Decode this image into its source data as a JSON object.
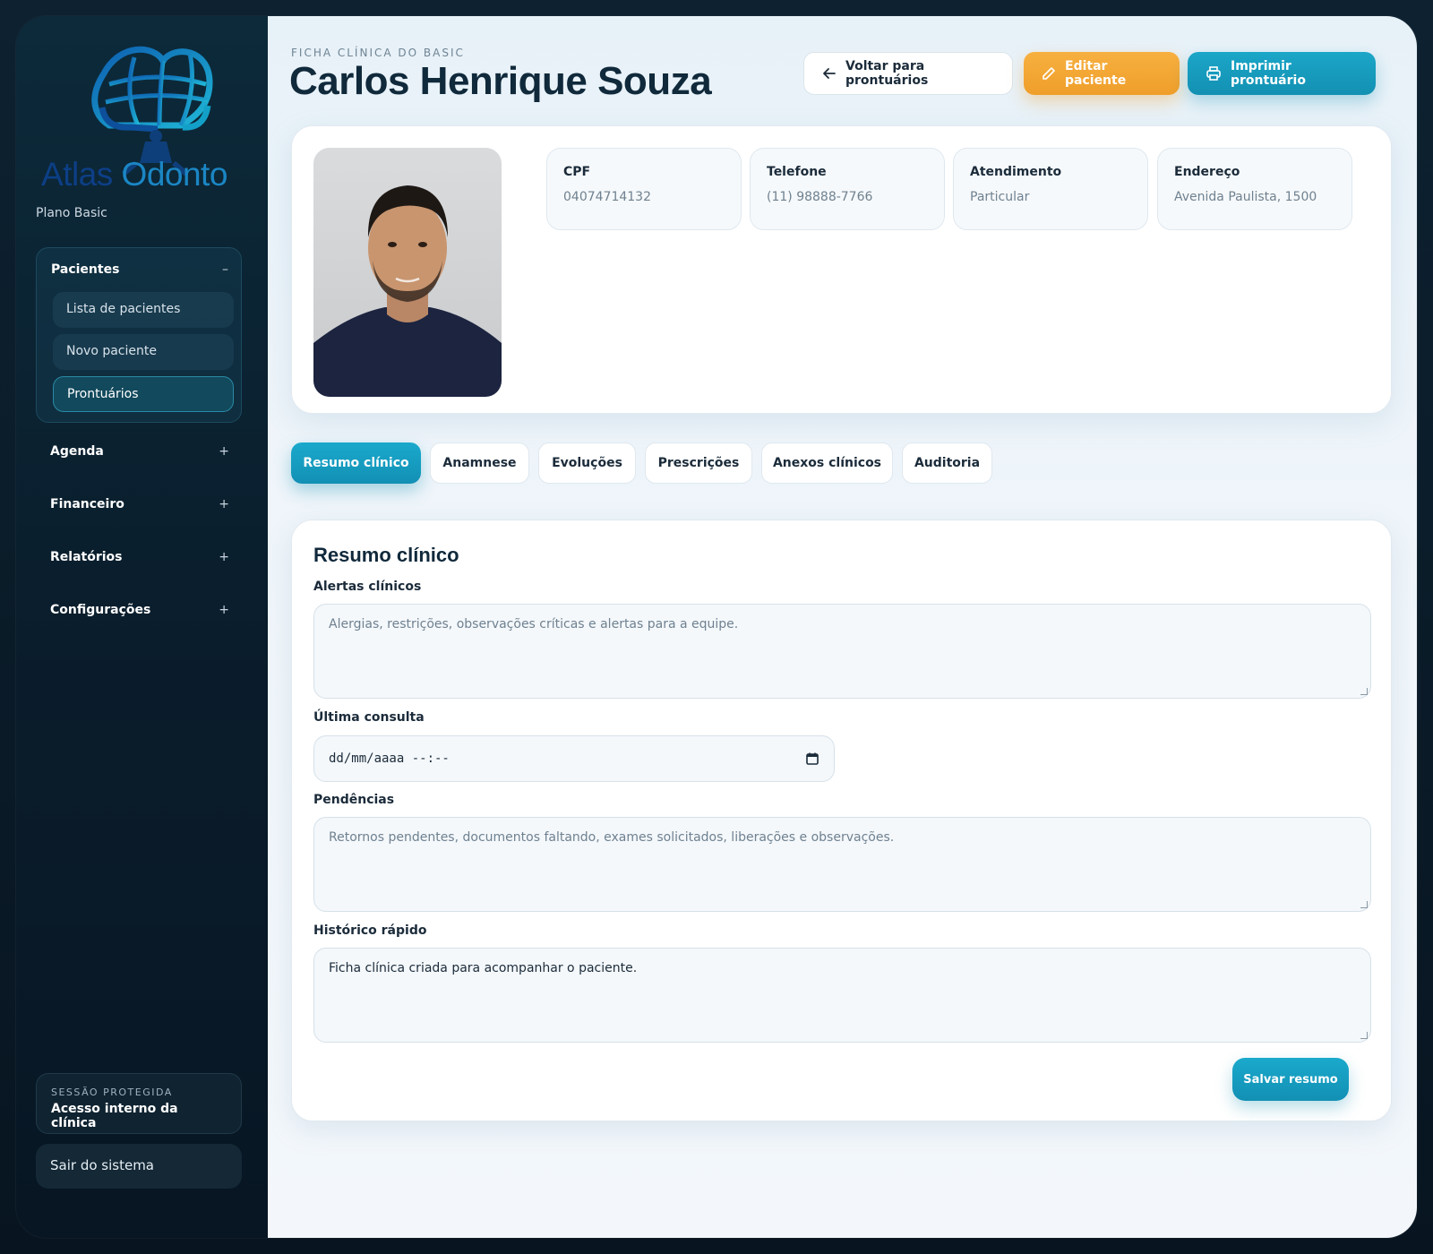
{
  "sidebar": {
    "brand": {
      "word1": "Atlas",
      "word2": "Odonto"
    },
    "plan": "Plano Basic",
    "pacientes": {
      "label": "Pacientes",
      "toggle": "–",
      "items": [
        "Lista de pacientes",
        "Novo paciente",
        "Prontuários"
      ],
      "active_index": 2
    },
    "sections": [
      {
        "label": "Agenda",
        "toggle": "+"
      },
      {
        "label": "Financeiro",
        "toggle": "+"
      },
      {
        "label": "Relatórios",
        "toggle": "+"
      },
      {
        "label": "Configurações",
        "toggle": "+"
      }
    ],
    "session": {
      "kicker": "SESSÃO PROTEGIDA",
      "value": "Acesso interno da clínica"
    },
    "logout": "Sair do sistema"
  },
  "header": {
    "eyebrow": "FICHA CLÍNICA DO BASIC",
    "title": "Carlos Henrique Souza",
    "back_label": "Voltar para prontuários",
    "edit_label": "Editar paciente",
    "print_label": "Imprimir prontuário"
  },
  "patient": {
    "fields": [
      {
        "label": "CPF",
        "value": "04074714132"
      },
      {
        "label": "Telefone",
        "value": "(11) 98888-7766"
      },
      {
        "label": "Atendimento",
        "value": "Particular"
      },
      {
        "label": "Endereço",
        "value": "Avenida Paulista, 1500"
      }
    ]
  },
  "tabs": [
    {
      "label": "Resumo clínico",
      "active": true
    },
    {
      "label": "Anamnese",
      "active": false
    },
    {
      "label": "Evoluções",
      "active": false
    },
    {
      "label": "Prescrições",
      "active": false
    },
    {
      "label": "Anexos clínicos",
      "active": false
    },
    {
      "label": "Auditoria",
      "active": false
    }
  ],
  "form": {
    "title": "Resumo clínico",
    "alerts": {
      "label": "Alertas clínicos",
      "placeholder": "Alergias, restrições, observações críticas e alertas para a equipe.",
      "value": ""
    },
    "last_visit": {
      "label": "Última consulta",
      "placeholder": "dd/mm/aaaa --:--"
    },
    "pending": {
      "label": "Pendências",
      "placeholder": "Retornos pendentes, documentos faltando, exames solicitados, liberações e observações.",
      "value": ""
    },
    "history": {
      "label": "Histórico rápido",
      "value": "Ficha clínica criada para acompanhar o paciente."
    },
    "save_label": "Salvar resumo"
  },
  "colors": {
    "accent": "#1390b2",
    "warning": "#ef9e2a",
    "sidebar_bg": "#0a1c2b",
    "title": "#10293b"
  }
}
